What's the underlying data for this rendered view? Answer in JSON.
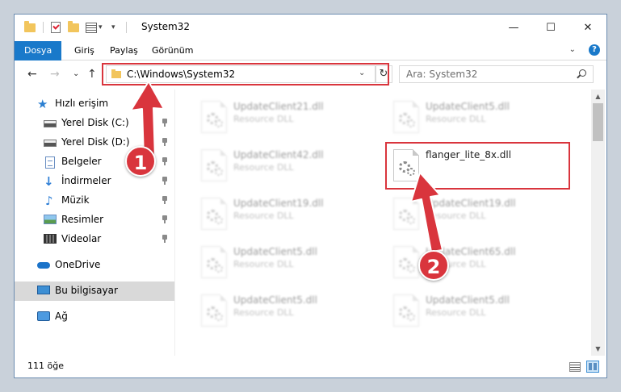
{
  "window": {
    "title": "System32",
    "minimize_glyph": "—",
    "maximize_glyph": "☐",
    "close_glyph": "✕"
  },
  "ribbon": {
    "tabs": [
      {
        "label": "Dosya",
        "active": true
      },
      {
        "label": "Giriş",
        "active": false
      },
      {
        "label": "Paylaş",
        "active": false
      },
      {
        "label": "Görünüm",
        "active": false
      }
    ],
    "help_glyph": "?"
  },
  "nav": {
    "back_glyph": "←",
    "forward_glyph": "→",
    "recent_glyph": "⌄",
    "up_glyph": "↑",
    "address": "C:\\Windows\\System32",
    "address_dropdown_glyph": "⌄",
    "refresh_glyph": "↻",
    "search_placeholder": "Ara: System32"
  },
  "sidebar": {
    "items": [
      {
        "label": "Hızlı erişim",
        "icon": "star-icon"
      },
      {
        "label": "Yerel Disk (C:)",
        "icon": "disk-icon",
        "pinned": true
      },
      {
        "label": "Yerel Disk (D:)",
        "icon": "disk-icon",
        "pinned": true
      },
      {
        "label": "Belgeler",
        "icon": "documents-icon",
        "pinned": true
      },
      {
        "label": "İndirmeler",
        "icon": "download-icon",
        "pinned": true
      },
      {
        "label": "Müzik",
        "icon": "music-icon",
        "pinned": true
      },
      {
        "label": "Resimler",
        "icon": "pictures-icon",
        "pinned": true
      },
      {
        "label": "Videolar",
        "icon": "videos-icon",
        "pinned": true
      },
      {
        "label": "OneDrive",
        "icon": "cloud-icon"
      },
      {
        "label": "Bu bilgisayar",
        "icon": "computer-icon",
        "selected": true
      },
      {
        "label": "Ağ",
        "icon": "network-icon"
      }
    ]
  },
  "files": [
    {
      "name": "UpdateClient21.dll",
      "type": "Resource DLL",
      "blurred": true
    },
    {
      "name": "UpdateClient5.dll",
      "type": "Resource DLL",
      "blurred": true
    },
    {
      "name": "UpdateClient42.dll",
      "type": "Resource DLL",
      "blurred": true
    },
    {
      "name": "flanger_lite_8x.dll",
      "type": "",
      "blurred": false
    },
    {
      "name": "UpdateClient19.dll",
      "type": "Resource DLL",
      "blurred": true
    },
    {
      "name": "UpdateClient19.dll",
      "type": "Resource DLL",
      "blurred": true
    },
    {
      "name": "UpdateClient5.dll",
      "type": "Resource DLL",
      "blurred": true
    },
    {
      "name": "UpdateClient65.dll",
      "type": "Resource DLL",
      "blurred": true
    },
    {
      "name": "UpdateClient5.dll",
      "type": "Resource DLL",
      "blurred": true
    },
    {
      "name": "UpdateClient5.dll",
      "type": "Resource DLL",
      "blurred": true
    }
  ],
  "status": {
    "item_count": "111 öğe"
  },
  "annotations": {
    "badge_1": "1",
    "badge_2": "2",
    "accent_color": "#d9353d"
  }
}
